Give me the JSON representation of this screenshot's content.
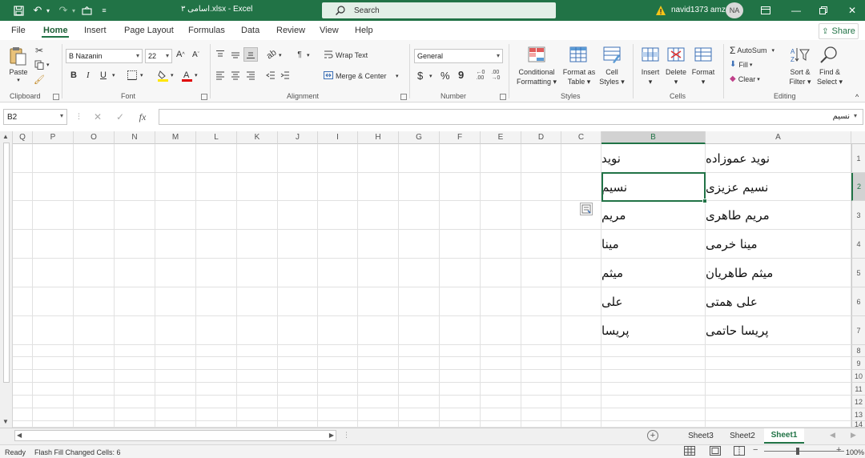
{
  "titlebar": {
    "doc_title": "اسامی ۳.xlsx  -  Excel",
    "search_label": "Search",
    "username": "navid1373 amz",
    "avatar_initials": "NA"
  },
  "menu": {
    "tabs": [
      "File",
      "Home",
      "Insert",
      "Page Layout",
      "Formulas",
      "Data",
      "Review",
      "View",
      "Help"
    ],
    "share": "Share"
  },
  "ribbon": {
    "clipboard": {
      "paste": "Paste",
      "label": "Clipboard"
    },
    "font": {
      "name": "B Nazanin",
      "size": "22",
      "bold": "B",
      "italic": "I",
      "underline": "U",
      "grow": "A",
      "shrink": "A",
      "label": "Font"
    },
    "alignment": {
      "wrap": "Wrap Text",
      "merge": "Merge & Center",
      "label": "Alignment"
    },
    "number": {
      "format": "General",
      "currency": "$",
      "percent": "%",
      "comma": "9",
      "label": "Number"
    },
    "styles": {
      "conditional_1": "Conditional",
      "conditional_2": "Formatting",
      "format_table_1": "Format as",
      "format_table_2": "Table",
      "cell_styles_1": "Cell",
      "cell_styles_2": "Styles",
      "label": "Styles"
    },
    "cells": {
      "insert": "Insert",
      "delete": "Delete",
      "format": "Format",
      "label": "Cells"
    },
    "editing": {
      "autosum": "AutoSum",
      "fill": "Fill",
      "clear": "Clear",
      "sort_1": "Sort &",
      "sort_2": "Filter",
      "find_1": "Find &",
      "find_2": "Select",
      "label": "Editing"
    }
  },
  "formula_bar": {
    "name_box": "B2",
    "fx": "fx",
    "value": "نسیم"
  },
  "grid": {
    "columns": [
      "Q",
      "P",
      "O",
      "N",
      "M",
      "L",
      "K",
      "J",
      "I",
      "H",
      "G",
      "F",
      "E",
      "D",
      "C",
      "B",
      "A"
    ],
    "rows": [
      "1",
      "2",
      "3",
      "4",
      "5",
      "6",
      "7",
      "8",
      "9",
      "10",
      "11",
      "12",
      "13",
      "14"
    ],
    "selected_cell": "B2",
    "col_a": [
      "نوید عموزاده",
      "نسیم عزیزی",
      "مریم طاهری",
      "مینا خرمی",
      "میثم طاهریان",
      "علی همتی",
      "پریسا حاتمی"
    ],
    "col_b": [
      "نوید",
      "نسیم",
      "مریم",
      "مینا",
      "میثم",
      "علی",
      "پریسا"
    ]
  },
  "sheets": {
    "tabs": [
      "Sheet3",
      "Sheet2",
      "Sheet1"
    ],
    "active": "Sheet1"
  },
  "status": {
    "ready": "Ready",
    "message": "Flash Fill Changed Cells: 6",
    "zoom": "100%"
  },
  "colors": {
    "accent": "#217346",
    "ribbon_bg": "#f7f7f7"
  }
}
